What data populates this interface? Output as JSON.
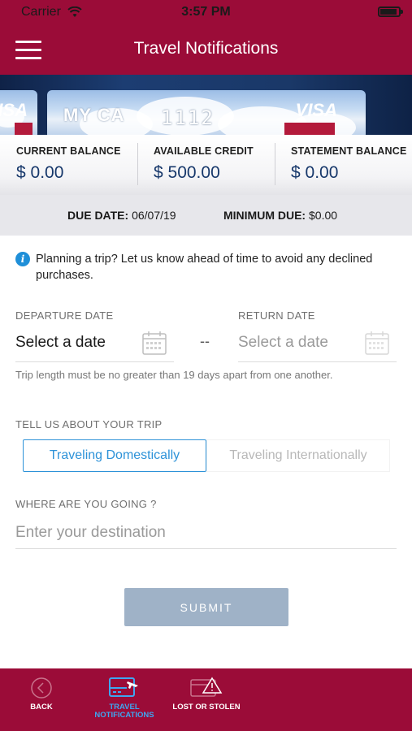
{
  "status_bar": {
    "carrier": "Carrier",
    "time": "3:57 PM"
  },
  "header": {
    "title": "Travel Notifications"
  },
  "cards": {
    "main_name": "MY CA",
    "main_number": "1112",
    "brand": "VISA"
  },
  "balances": [
    {
      "label": "CURRENT BALANCE",
      "value": "$ 0.00"
    },
    {
      "label": "AVAILABLE CREDIT",
      "value": "$ 500.00"
    },
    {
      "label": "STATEMENT BALANCE",
      "value": "$ 0.00"
    }
  ],
  "due": {
    "due_label": "DUE DATE:",
    "due_value": "06/07/19",
    "min_label": "MINIMUM DUE:",
    "min_value": "$0.00"
  },
  "info": {
    "text": "Planning a trip? Let us know ahead of time to avoid any declined purchases."
  },
  "dates": {
    "departure_label": "DEPARTURE DATE",
    "departure_value": "Select a date",
    "separator": "--",
    "return_label": "RETURN DATE",
    "return_value": "Select a date",
    "hint": "Trip length must be no greater than 19 days apart from one another."
  },
  "trip": {
    "label": "TELL US ABOUT YOUR TRIP",
    "options": [
      "Traveling Domestically",
      "Traveling Internationally"
    ],
    "selected": "Traveling Domestically"
  },
  "destination": {
    "label": "WHERE ARE YOU GOING ?",
    "placeholder": "Enter your destination"
  },
  "submit": {
    "label": "SUBMIT"
  },
  "tabbar": {
    "items": [
      {
        "label": "BACK",
        "icon": "back-icon"
      },
      {
        "label": "TRAVEL NOTIFICATIONS",
        "icon": "travel-card-icon"
      },
      {
        "label": "LOST OR STOLEN",
        "icon": "lost-card-warning-icon"
      }
    ],
    "active": "TRAVEL NOTIFICATIONS"
  },
  "colors": {
    "brand": "#9b0c38",
    "accent": "#2d92d8",
    "balance_value": "#17386b",
    "submit_disabled": "#9fb2c7"
  }
}
